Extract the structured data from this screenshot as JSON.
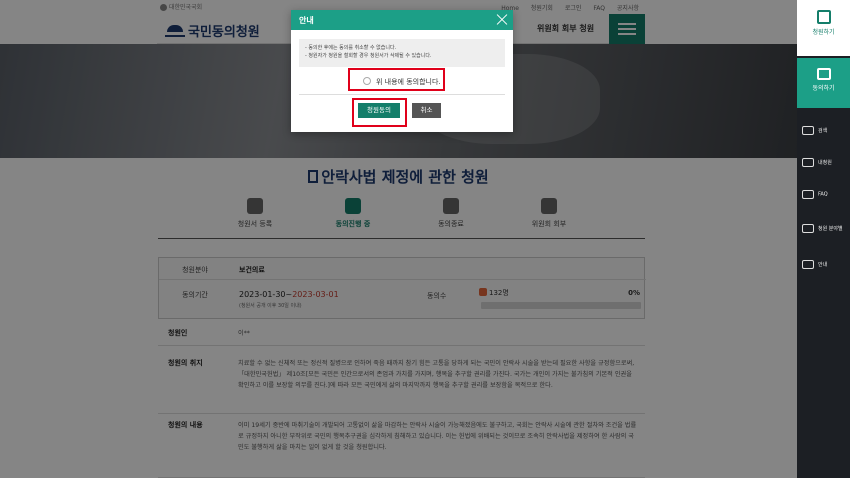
{
  "header": {
    "assembly_label": "대한민국국회",
    "top_links": [
      "Home",
      "청원기회",
      "로그인",
      "FAQ",
      "공지사항"
    ],
    "logo_text": "국민동의청원",
    "member_link": "위원회 회부 청원"
  },
  "sidebar": {
    "items": [
      {
        "label": "청원하기",
        "icon": "petition-write-icon"
      },
      {
        "label": "동의하기",
        "icon": "agree-hand-icon"
      },
      {
        "label": "검색",
        "icon": "search-icon"
      },
      {
        "label": "내청원",
        "icon": "my-petition-icon"
      },
      {
        "label": "FAQ",
        "icon": "faq-icon"
      },
      {
        "label": "청원 분야별",
        "icon": "category-tree-icon"
      },
      {
        "label": "안내",
        "icon": "guide-icon"
      }
    ]
  },
  "petition": {
    "title": "안락사법 제정에 관한 청원",
    "steps": [
      {
        "label": "청원서 등록",
        "active": false
      },
      {
        "label": "동의진행 중",
        "active": true
      },
      {
        "label": "동의종료",
        "active": false
      },
      {
        "label": "위원회 회부",
        "active": false
      }
    ],
    "field_label": "청원분야",
    "field_value": "보건의료",
    "period_label": "동의기간",
    "period_start": "2023-01-30",
    "period_sep": "~",
    "period_end": "2023-03-01",
    "period_note": "(청원서 공개 이후 30일 이내)",
    "agree_label": "동의수",
    "agree_count": "132명",
    "agree_percent_text": "0%",
    "agree_progress": 0,
    "petitioner_label": "청원인",
    "petitioner_value": "이**",
    "purpose_label": "청원의 취지",
    "purpose_text": "치료할 수 없는 신체적 또는 정신적 질병으로 인하여 죽음 때까지 참기 힘든 고통을 당하게 되는 국민이 안락사 시술을 받는데 필요한 사항을 규정함으로써, 「대한민국헌법」 제10조[모든 국민은 인간으로서의 존엄과 가치를 가지며, 행복을 추구할 권리를 가진다. 국가는 개인이 가지는 불가침의 기본적 인권을 확인하고 이를 보장할 의무를 진다.]에 따라 모든 국민에게 삶의 마지막까지 행복을 추구할 권리를 보장함을 목적으로 한다.",
    "content_label": "청원의 내용",
    "content_text": "이미 19세기 중반에 마취기술이 개발되어 고통없이 삶을 마감하는 안락사 시술이 가능해졌음에도 불구하고, 국회는 안락사 시술에 관한 절차와 조건을 법률로 규정하지 아니한 부작위로 국민의 행복추구권을 심각하게 침해하고 있습니다. 이는 헌법에 위배되는 것이므로 조속히 안락사법을 제정하여 한 사람의 국민도 불행하게 삶을 마치는 일이 없게 할 것을 청원합니다."
  },
  "modal": {
    "title": "안내",
    "notice_lines": [
      "- 동의한 후에는 동의를 취소할 수 없습니다.",
      "- 청원자가 청원을 철회할 경우 청원서가 삭제될 수 있습니다."
    ],
    "checkbox_label": "위 내용에 동의합니다.",
    "agree_button": "청원동의",
    "cancel_button": "취소"
  },
  "colors": {
    "accent": "#1c9f87",
    "accent_dark": "#147e6a",
    "highlight": "#e0001a",
    "period_end": "#c0392b"
  }
}
